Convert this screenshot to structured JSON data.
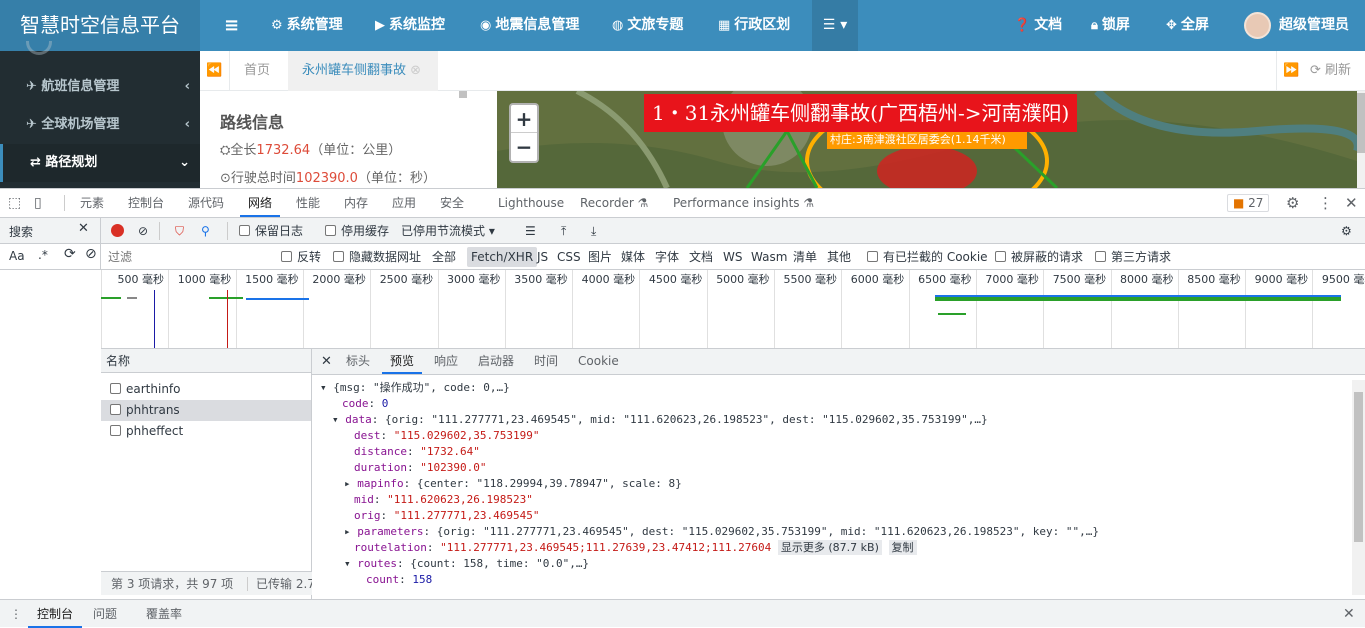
{
  "app": {
    "title": "智慧时空信息平台",
    "nav": [
      {
        "icon": "gear-icon",
        "glyph": "⚙",
        "label": "系统管理"
      },
      {
        "icon": "video-icon",
        "glyph": "■",
        "label": "系统监控"
      },
      {
        "icon": "map-marker-icon",
        "glyph": "◉",
        "label": "地震信息管理"
      },
      {
        "icon": "globe-icon",
        "glyph": "◍",
        "label": "文旅专题"
      },
      {
        "icon": "bank-icon",
        "glyph": "▦",
        "label": "行政区划"
      }
    ],
    "right": [
      {
        "icon": "question-icon",
        "glyph": "?",
        "label": "文档"
      },
      {
        "icon": "lock-icon",
        "glyph": "▣",
        "label": "锁屏"
      },
      {
        "icon": "expand-icon",
        "glyph": "✥",
        "label": "全屏"
      }
    ],
    "user": "超级管理员"
  },
  "sidebar": [
    {
      "label": "航班信息管理",
      "icon": "plane-icon",
      "glyph": "✈"
    },
    {
      "label": "全球机场管理",
      "icon": "plane-icon",
      "glyph": "✈"
    },
    {
      "label": "路径规划",
      "icon": "route-icon",
      "glyph": "⇄"
    }
  ],
  "tabs": {
    "home": "首页",
    "active": "永州罐车侧翻事故",
    "refresh": "刷新"
  },
  "route": {
    "title": "路线信息",
    "length_prefix": "全长",
    "length_value": "1732.64",
    "length_unit": "（单位：公里）",
    "time_prefix": "行驶总时间",
    "time_value": "102390.0",
    "time_unit": "（单位：秒）"
  },
  "map": {
    "banner": "1・31永州罐车侧翻事故(广西梧州->河南濮阳)",
    "label1": "村庄:3南津渡社区居委会(1.14千米)",
    "zoom_in": "+",
    "zoom_out": "−"
  },
  "devtools": {
    "tabs": [
      "元素",
      "控制台",
      "源代码",
      "网络",
      "性能",
      "内存",
      "应用",
      "安全",
      "Lighthouse",
      "Recorder",
      "Performance insights"
    ],
    "issues": "27",
    "search_label": "搜索",
    "preserve_log": "保留日志",
    "disable_cache": "停用缓存",
    "throttle": "已停用节流模式",
    "filter_placeholder": "过滤",
    "invert": "反转",
    "hide_data": "隐藏数据网址",
    "all": "全部",
    "types": [
      "Fetch/XHR",
      "JS",
      "CSS",
      "图片",
      "媒体",
      "字体",
      "文档",
      "WS",
      "Wasm",
      "清单",
      "其他"
    ],
    "blocked_cookies": "有已拦截的 Cookie",
    "blocked_req": "被屏蔽的请求",
    "third_party": "第三方请求",
    "ticks": [
      "500 毫秒",
      "1000 毫秒",
      "1500 毫秒",
      "2000 毫秒",
      "2500 毫秒",
      "3000 毫秒",
      "3500 毫秒",
      "4000 毫秒",
      "4500 毫秒",
      "5000 毫秒",
      "5500 毫秒",
      "6000 毫秒",
      "6500 毫秒",
      "7000 毫秒",
      "7500 毫秒",
      "8000 毫秒",
      "8500 毫秒",
      "9000 毫秒",
      "9500 毫秒"
    ],
    "name_header": "名称",
    "requests": [
      "earthinfo",
      "phhtrans",
      "phheffect"
    ],
    "status": "第 3 项请求，共 97 项",
    "transferred": "已传输 2.7 I",
    "detail_tabs": [
      "标头",
      "预览",
      "响应",
      "启动器",
      "时间",
      "Cookie"
    ],
    "show_more": "显示更多 (87.7 kB)",
    "copy": "复制",
    "drawer_tabs": [
      "控制台",
      "问题",
      "覆盖率"
    ]
  },
  "json": {
    "root": "{msg: \"操作成功\", code: 0,…}",
    "code_key": "code",
    "code_val": "0",
    "data_key": "data",
    "data_sum": "{orig: \"111.277771,23.469545\", mid: \"111.620623,26.198523\", dest: \"115.029602,35.753199\",…}",
    "dest_key": "dest",
    "dest_val": "\"115.029602,35.753199\"",
    "distance_key": "distance",
    "distance_val": "\"1732.64\"",
    "duration_key": "duration",
    "duration_val": "\"102390.0\"",
    "mapinfo_key": "mapinfo",
    "mapinfo_val": "{center: \"118.29994,39.78947\", scale: 8}",
    "mid_key": "mid",
    "mid_val": "\"111.620623,26.198523\"",
    "orig_key": "orig",
    "orig_val": "\"111.277771,23.469545\"",
    "parameters_key": "parameters",
    "parameters_val": "{orig: \"111.277771,23.469545\", dest: \"115.029602,35.753199\", mid: \"111.620623,26.198523\", key: \"\",…}",
    "routelation_key": "routelation",
    "routelation_val": "\"111.277771,23.469545;111.27639,23.47412;111.27604",
    "routes_key": "routes",
    "routes_val": "{count: 158, time: \"0.0\",…}",
    "count_key": "count",
    "count_val": "158"
  }
}
